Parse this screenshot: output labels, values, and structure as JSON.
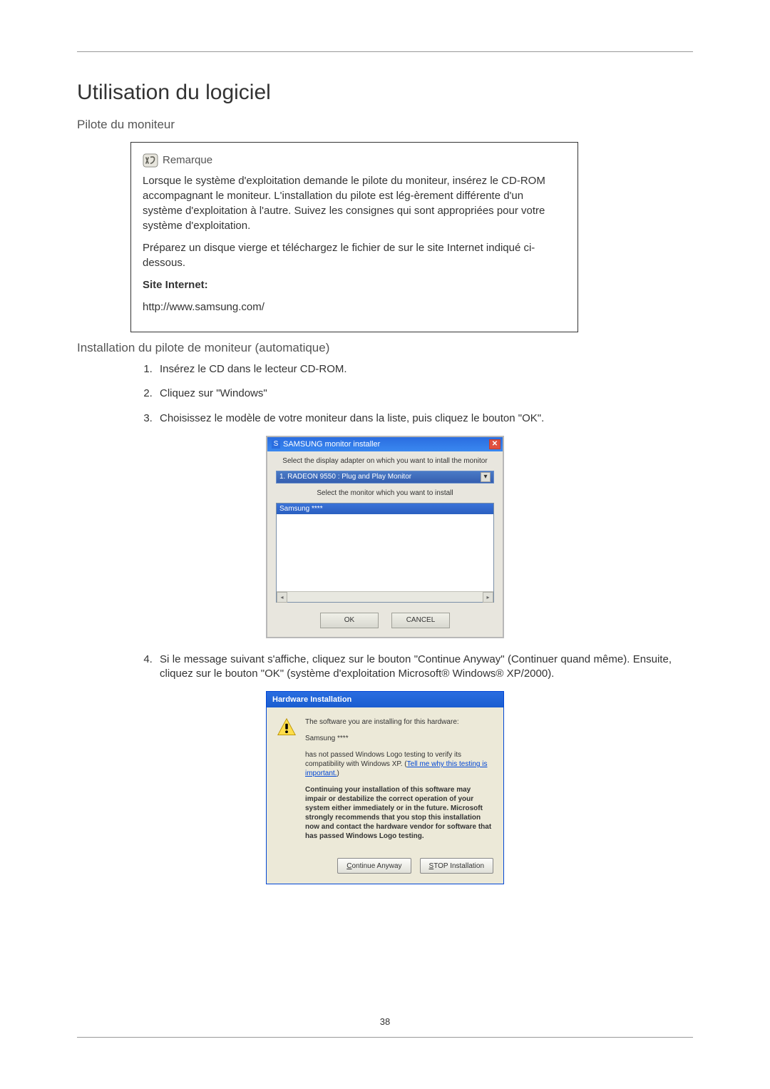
{
  "page_number": "38",
  "heading_main": "Utilisation du logiciel",
  "heading_sub1": "Pilote du moniteur",
  "remarque": {
    "title": "Remarque",
    "p1": "Lorsque le système d'exploitation demande le pilote du moniteur, insérez le CD-ROM accompagnant le moniteur. L'installation du pilote est lég-èrement différente d'un système d'exploitation à l'autre. Suivez les consignes qui sont appropriées pour votre système d'exploitation.",
    "p2": "Préparez un disque vierge et téléchargez le fichier de sur le site Internet indiqué ci-dessous.",
    "label_site": "Site Internet:",
    "url": "http://www.samsung.com/"
  },
  "heading_sub2": "Installation du pilote de moniteur (automatique)",
  "steps": {
    "s1": "Insérez le CD dans le lecteur CD-ROM.",
    "s2": "Cliquez sur \"Windows\"",
    "s3": "Choisissez le modèle de votre moniteur dans la liste, puis cliquez le bouton \"OK\".",
    "s4": "Si le message suivant s'affiche, cliquez sur le bouton \"Continue Anyway\" (Continuer quand même). Ensuite, cliquez sur le bouton \"OK\" (système d'exploitation Microsoft® Windows® XP/2000)."
  },
  "installer": {
    "title": "SAMSUNG monitor installer",
    "icon_text": "S",
    "label1": "Select the display adapter on which you want to intall the monitor",
    "dropdown_value": "1. RADEON 9550 : Plug and Play Monitor",
    "label2": "Select the monitor which you want to install",
    "list_selected": "Samsung ****",
    "btn_ok": "OK",
    "btn_cancel": "CANCEL"
  },
  "hw_install": {
    "title": "Hardware Installation",
    "p1": "The software you are installing for this hardware:",
    "p2": "Samsung ****",
    "p3a": "has not passed Windows Logo testing to verify its compatibility with Windows XP. (",
    "p3_link": "Tell me why this testing is important.",
    "p3b": ")",
    "p4": "Continuing your installation of this software may impair or destabilize the correct operation of your system either immediately or in the future. Microsoft strongly recommends that you stop this installation now and contact the hardware vendor for software that has passed Windows Logo testing.",
    "btn_continue_prefix": "C",
    "btn_continue_rest": "ontinue Anyway",
    "btn_stop_prefix": "S",
    "btn_stop_rest": "TOP Installation"
  }
}
